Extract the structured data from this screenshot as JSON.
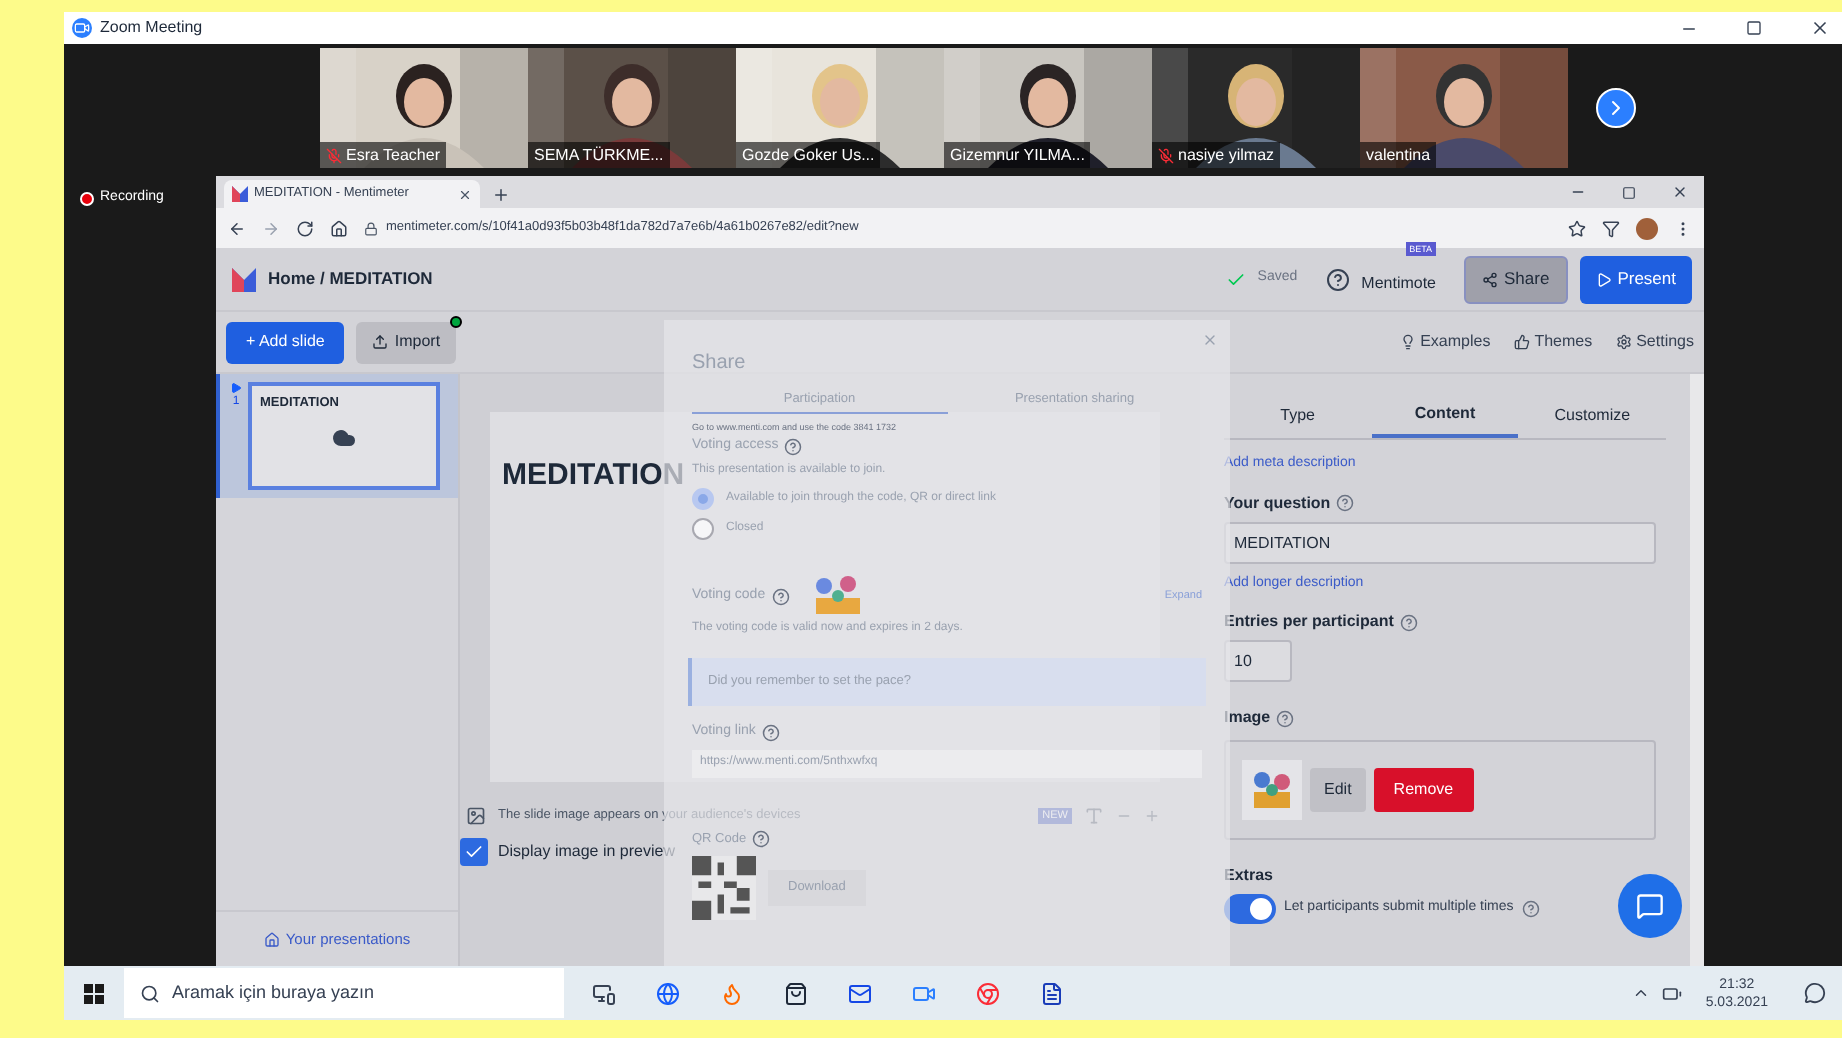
{
  "zoom": {
    "title": "Zoom Meeting",
    "recording": "Recording"
  },
  "participants": [
    {
      "name": "Esra Teacher",
      "muted": true
    },
    {
      "name": "SEMA TÜRKME...",
      "muted": false
    },
    {
      "name": "Gozde Goker Us...",
      "muted": false
    },
    {
      "name": "Gizemnur YILMA...",
      "muted": false
    },
    {
      "name": "nasiye yilmaz",
      "muted": true
    },
    {
      "name": "valentina",
      "muted": false
    }
  ],
  "browser": {
    "tab": "MEDITATION - Mentimeter",
    "url": "mentimeter.com/s/10f41a0d93f5b03b48f1da782d7a7e6b/4a61b0267e82/edit?new"
  },
  "header": {
    "breadcrumb": "Home / MEDITATION",
    "saved": "Saved",
    "mentimote": "Mentimote",
    "beta": "BETA",
    "share": "Share",
    "present": "Present"
  },
  "toolbar": {
    "add_slide": "+ Add slide",
    "import": "Import",
    "links": [
      "Examples",
      "Themes",
      "Settings"
    ]
  },
  "slides": [
    {
      "number": "1",
      "title": "MEDITATION",
      "selected": true
    }
  ],
  "your_presentations": "Your presentations",
  "canvas": {
    "heading": "MEDITATION",
    "image_note": "The slide image appears on your audience's devices",
    "new_badge": "NEW",
    "display_image": {
      "label": "Display image in preview",
      "checked": true
    }
  },
  "share_dialog": {
    "title": "Share",
    "tabs": [
      {
        "label": "Participation",
        "selected": true
      },
      {
        "label": "Presentation sharing",
        "selected": false
      }
    ],
    "instructions": "Go to www.menti.com and use the code 3841 1732",
    "access_label": "Voting access",
    "access_text": "This presentation is available to join.",
    "options": [
      {
        "label": "Available to join through the code, QR or direct link",
        "selected": true
      },
      {
        "label": "Closed",
        "selected": false
      }
    ],
    "code_label": "Voting code",
    "expand": "Expand",
    "code_text": "The voting code is valid now and expires in 2 days.",
    "reminder": "Did you remember to set the pace?",
    "link_label": "Voting link",
    "link": "https://www.menti.com/5nthxwfxq",
    "qr_label": "QR Code",
    "download": "Download"
  },
  "panel": {
    "tabs": [
      {
        "label": "Type",
        "selected": false
      },
      {
        "label": "Content",
        "selected": true
      },
      {
        "label": "Customize",
        "selected": false
      }
    ],
    "meta_link": "Add meta description",
    "question_label": "Your question",
    "question": "MEDITATION",
    "longer_link": "Add longer description",
    "entries_label": "Entries per participant",
    "entries": "10",
    "image_label": "Image",
    "edit": "Edit",
    "remove": "Remove",
    "extras": "Extras",
    "multiple": {
      "label": "Let participants submit multiple times",
      "on": true
    }
  },
  "taskbar": {
    "search_placeholder": "Aramak için buraya yazın",
    "time": "21:32",
    "date": "5.03.2021"
  }
}
